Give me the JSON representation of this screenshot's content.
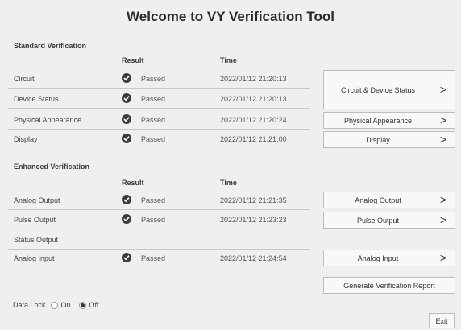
{
  "title": "Welcome to VY Verification Tool",
  "standard": {
    "heading": "Standard Verification",
    "result_header": "Result",
    "time_header": "Time",
    "rows": [
      {
        "label": "Circuit",
        "status": "Passed",
        "time": "2022/01/12 21:20:13"
      },
      {
        "label": "Device Status",
        "status": "Passed",
        "time": "2022/01/12 21:20:13"
      },
      {
        "label": "Physical Appearance",
        "status": "Passed",
        "time": "2022/01/12 21:20:24"
      },
      {
        "label": "Display",
        "status": "Passed",
        "time": "2022/01/12 21:21:00"
      }
    ],
    "buttons": [
      "Circuit & Device Status",
      "Physical Appearance",
      "Display"
    ]
  },
  "enhanced": {
    "heading": "Enhanced Verification",
    "result_header": "Result",
    "time_header": "Time",
    "rows": [
      {
        "label": "Analog Output",
        "status": "Passed",
        "time": "2022/01/12 21:21:35"
      },
      {
        "label": "Pulse Output",
        "status": "Passed",
        "time": "2022/01/12 21:23:23"
      },
      {
        "label": "Status Output",
        "status": "",
        "time": ""
      },
      {
        "label": "Analog Input",
        "status": "Passed",
        "time": "2022/01/12 21:24:54"
      }
    ],
    "buttons": [
      "Analog Output",
      "Pulse Output",
      "Analog Input"
    ]
  },
  "report_button": "Generate Verification Report",
  "data_lock": {
    "label": "Data Lock",
    "on": "On",
    "off": "Off",
    "selected": "Off"
  },
  "exit_button": "Exit",
  "icons": {
    "check": "check-circle-icon",
    "chevron": "chevron-right-icon"
  },
  "chevron_glyph": ">"
}
